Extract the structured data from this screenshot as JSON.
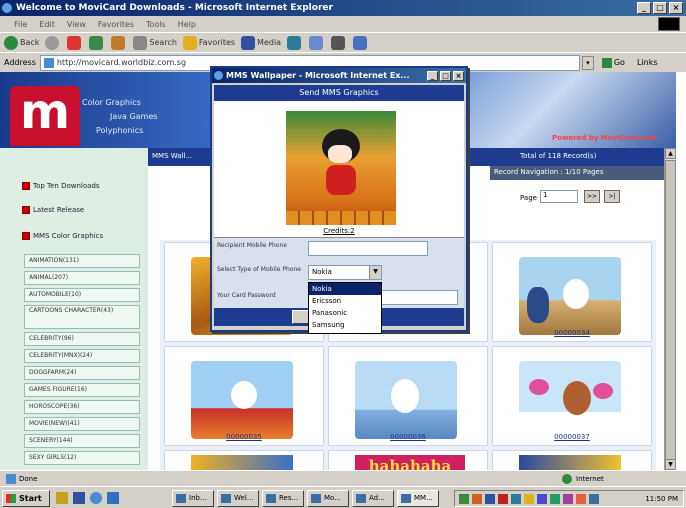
{
  "colors": {
    "titlebar": "#0a246a",
    "banner": "#234aa0",
    "logo_red": "#c8102e",
    "sidebar": "#dfeee2",
    "accent_blue": "#1d3c8f"
  },
  "main_window": {
    "title": "Welcome to MoviCard Downloads - Microsoft Internet Explorer",
    "buttons": {
      "min": "_",
      "max": "□",
      "close": "×"
    }
  },
  "menu": [
    "File",
    "Edit",
    "View",
    "Favorites",
    "Tools",
    "Help"
  ],
  "toolbar": {
    "back": "Back",
    "search": "Search",
    "favorites": "Favorites",
    "media": "Media"
  },
  "address": {
    "label": "Address",
    "value": "http://movicard.worldbiz.com.sg",
    "go": "Go",
    "links": "Links"
  },
  "banner": {
    "line1": "Color Graphics",
    "line2": "Java Games",
    "line3": "Polyphonics",
    "powered": "Powered by MoviCard.com"
  },
  "tab_strip": {
    "label": "MMS Wall..."
  },
  "records": {
    "total": "Total of 118 Record(s)",
    "navigation": "Record Navigation : 1/10 Pages",
    "page_label": "Page",
    "page_value": "1",
    "next": ">>",
    "last": ">|"
  },
  "nav_links": [
    "Top Ten Downloads",
    "Latest Release",
    "MMS Color Graphics"
  ],
  "categories": [
    "ANIMATION(131)",
    "ANIMAL(207)",
    "AUTOMOBILE(10)",
    "CARTOONS CHARACTER(43)",
    "CELEBRITY(96)",
    "CELEBRITY(MNX)(24)",
    "DOGGFARM(24)",
    "GAMES FIGURE(16)",
    "HOROSCOPE(36)",
    "MOVIE(NEW)(41)",
    "SCENERY(144)",
    "SEXY GIRLS(12)"
  ],
  "thumbnails": [
    {
      "caption": ""
    },
    {
      "caption": ""
    },
    {
      "caption": "00000034"
    },
    {
      "caption": "00000035"
    },
    {
      "caption": "00000036"
    },
    {
      "caption": "00000037"
    },
    {
      "caption": ""
    },
    {
      "caption": "hahahaha"
    },
    {
      "caption": ""
    }
  ],
  "popup": {
    "title": "MMS Wallpaper - Microsoft Internet Ex...",
    "heading": "Send MMS Graphics",
    "image_caption": "Credits:2",
    "phone_label": "Recipient Mobile Phone",
    "phone_value": "",
    "phone_type_label": "Select Type of Mobile Phone",
    "phone_type_value": "Nokia",
    "card_label": "Your Card Password",
    "options": [
      "Nokia",
      "Ericsson",
      "Panasonic",
      "Samsung"
    ]
  },
  "statusbar": {
    "left": "Done",
    "right": "Internet"
  },
  "taskbar": {
    "start": "Start",
    "tasks": [
      "Inb...",
      "Wel...",
      "Res...",
      "Mo...",
      "Ad...",
      "MM..."
    ],
    "clock": "11:50 PM"
  }
}
